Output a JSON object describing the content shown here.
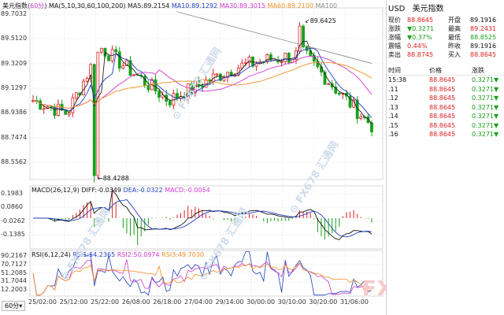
{
  "header": {
    "title": "美元指数",
    "period": "60分",
    "ma_label": "MA(5,10,30,60,100,200)",
    "ma5": "MA5:89.2154",
    "ma10": "MA10:89.1292",
    "ma30": "MA30:89.3015",
    "ma60": "MA60:89.2100",
    "ma100": "MA100"
  },
  "price_axis": [
    "89.7032",
    "89.5120",
    "89.3209",
    "89.1297",
    "88.9386",
    "88.7474",
    "88.5562"
  ],
  "annotations": {
    "high": "89.6425",
    "low": "88.4288"
  },
  "macd": {
    "label": "MACD(26,12,9)",
    "diff": "DIFF:-0.0349",
    "dea": "DEA:-0.0322",
    "macd": "MACD:-0.0054",
    "axis": [
      "0.1983",
      "0.0860",
      "-0.0262",
      "-0.1385"
    ]
  },
  "rsi": {
    "label": "RSI(6,12,24)",
    "rsi1": "RSI1:54.2365",
    "rsi2": "RSI2:50.0974",
    "rsi3": "RSI3:49.7030",
    "axis": [
      "90.2167",
      "70.7127",
      "51.2085",
      "31.7044",
      "12.2003"
    ]
  },
  "time_axis": [
    "25/02:00",
    "25/12:00",
    "25/22:00",
    "26/08:00",
    "26/18:00",
    "27/04:00",
    "29/14:00",
    "30/00:00",
    "30/10:00",
    "30/20:00",
    "31/06:00"
  ],
  "period_selector": "60分",
  "quote": {
    "symbol": "USD",
    "name": "美元指数",
    "rows": [
      {
        "l1": "现价",
        "v1": "88.8645",
        "l2": "开盘",
        "v2": "89.1916",
        "c1": "red",
        "c2": "dark"
      },
      {
        "l1": "涨跌",
        "v1": "▼0.3271",
        "l2": "最高",
        "v2": "89.2431",
        "c1": "green",
        "c2": "red"
      },
      {
        "l1": "涨幅",
        "v1": "▼0.37%",
        "l2": "最低",
        "v2": "88.8525",
        "c1": "green",
        "c2": "green"
      },
      {
        "l1": "震幅",
        "v1": "0.44%",
        "l2": "昨收",
        "v2": "89.1916",
        "c1": "red",
        "c2": "dark"
      },
      {
        "l1": "卖出",
        "v1": "88.8745",
        "l2": "买入",
        "v2": "88.8645",
        "c1": "red",
        "c2": "red"
      }
    ]
  },
  "ticks": {
    "headers": [
      "时间",
      "价格",
      "涨跌"
    ],
    "rows": [
      {
        "t": "15:38",
        "p": "88.8645",
        "c": "0.3271▼"
      },
      {
        "t": ".11",
        "p": "88.8645",
        "c": "0.3271▼"
      },
      {
        "t": ".12",
        "p": "88.8645",
        "c": "0.3271▼"
      },
      {
        "t": ".13",
        "p": "88.8645",
        "c": "0.3271▼"
      },
      {
        "t": ".14",
        "p": "88.8645",
        "c": "0.3271▼"
      },
      {
        "t": ".15",
        "p": "88.8645",
        "c": "0.3271▼"
      },
      {
        "t": ".16",
        "p": "88.8645",
        "c": "0.3271▼"
      }
    ]
  },
  "watermark": {
    "brand_a": "FX678",
    "brand_b": "汇通网"
  },
  "colors": {
    "up": "#e02020",
    "down": "#17a01b",
    "ma5": "#222222",
    "ma10": "#1f3fbf",
    "ma30": "#d03bd0",
    "ma60": "#f09020",
    "ma100": "#888888"
  },
  "chart_data": {
    "type": "candlestick",
    "categories": [
      "25/02:00",
      "25/12:00",
      "25/22:00",
      "26/08:00",
      "26/18:00",
      "27/04:00",
      "29/14:00",
      "30/00:00",
      "30/10:00",
      "30/20:00",
      "31/06:00"
    ],
    "close": [
      89.05,
      88.95,
      89.45,
      89.25,
      89.05,
      89.18,
      89.3,
      89.36,
      89.4,
      89.12,
      88.86
    ],
    "ylim": [
      88.45,
      89.75
    ],
    "high": 89.6425,
    "low": 88.4288
  }
}
